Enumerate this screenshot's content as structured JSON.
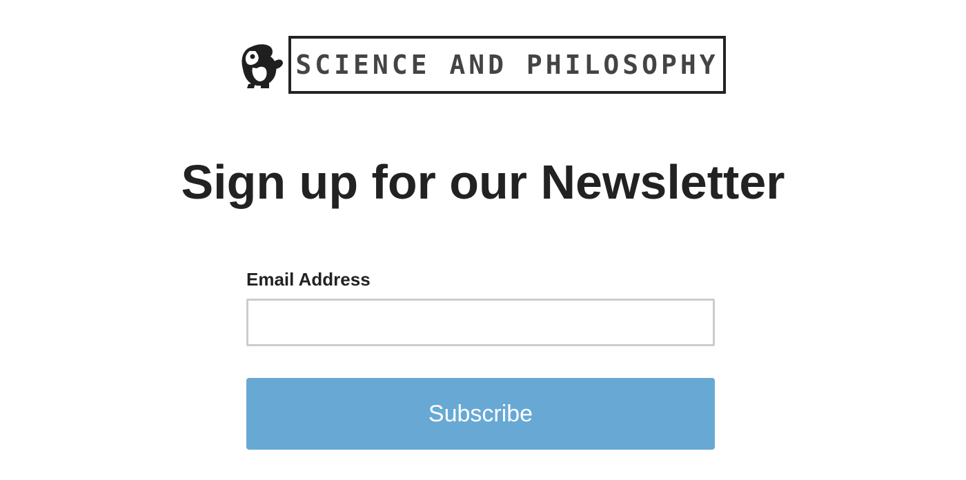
{
  "logo": {
    "mascot_icon": "penguin-mascot-icon",
    "text": "SCIENCE AND PHILOSOPHY"
  },
  "heading": "Sign up for our Newsletter",
  "form": {
    "email_label": "Email Address",
    "email_value": "",
    "email_placeholder": "",
    "subscribe_label": "Subscribe"
  },
  "colors": {
    "button_background": "#67a9d4",
    "button_text": "#ffffff",
    "heading_text": "#222222",
    "input_border": "#cccccc"
  }
}
